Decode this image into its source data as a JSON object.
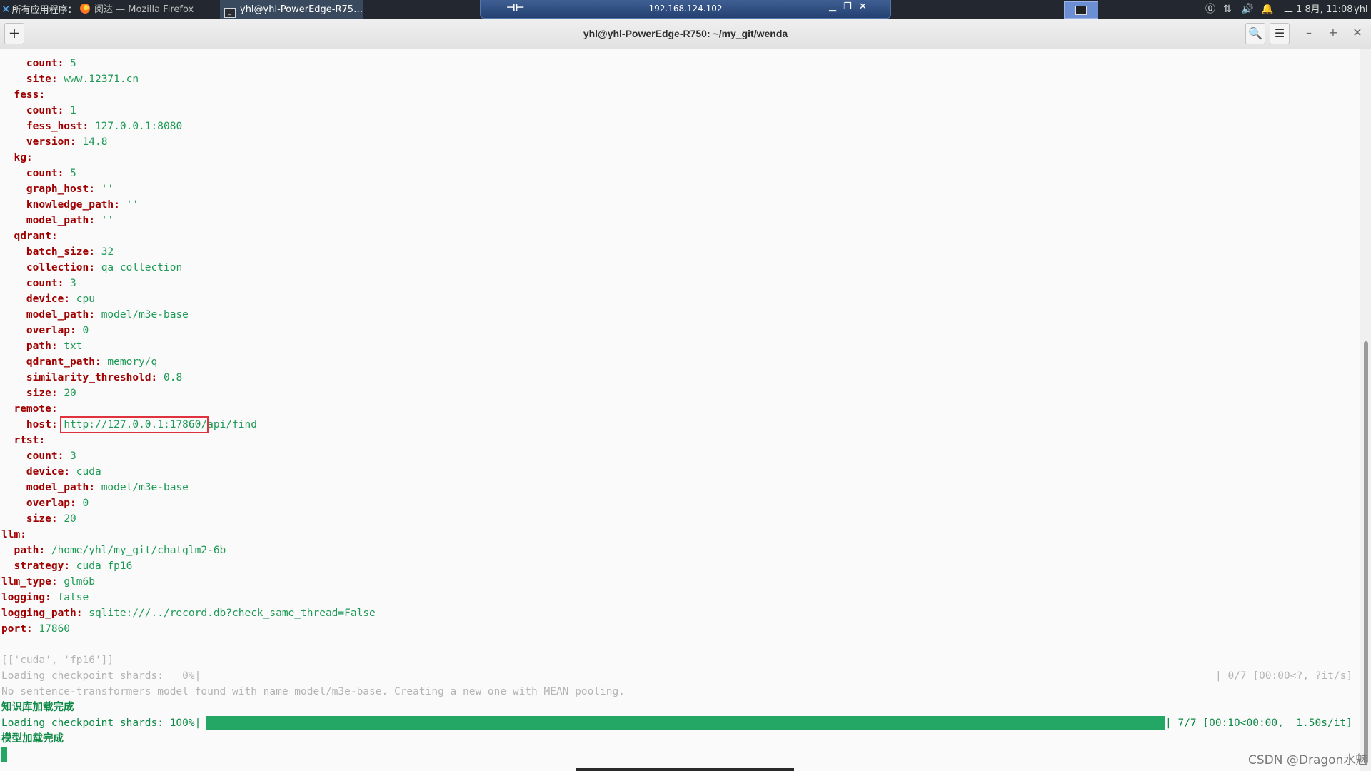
{
  "panel": {
    "apps_label": "所有应用程序：",
    "task1": "阅达 — Mozilla Firefox",
    "task2": "yhl@yhl-PowerEdge-R75…",
    "vnc_ip": "192.168.124.102",
    "clock": "二 1 8月, 11:08",
    "user": "yhl"
  },
  "window": {
    "title": "yhl@yhl-PowerEdge-R750: ~/my_git/wenda",
    "new_tab": "+",
    "minimize": "–",
    "maximize": "+",
    "close": "✕"
  },
  "terminal": {
    "lines": [
      {
        "k": "    count: ",
        "v": "5"
      },
      {
        "k": "    site: ",
        "v": "www.12371.cn"
      },
      {
        "k": "  fess:",
        "v": ""
      },
      {
        "k": "    count: ",
        "v": "1"
      },
      {
        "k": "    fess_host: ",
        "v": "127.0.0.1:8080"
      },
      {
        "k": "    version: ",
        "v": "14.8"
      },
      {
        "k": "  kg:",
        "v": ""
      },
      {
        "k": "    count: ",
        "v": "5"
      },
      {
        "k": "    graph_host: ",
        "v": "''"
      },
      {
        "k": "    knowledge_path: ",
        "v": "''"
      },
      {
        "k": "    model_path: ",
        "v": "''"
      },
      {
        "k": "  qdrant:",
        "v": ""
      },
      {
        "k": "    batch_size: ",
        "v": "32"
      },
      {
        "k": "    collection: ",
        "v": "qa_collection"
      },
      {
        "k": "    count: ",
        "v": "3"
      },
      {
        "k": "    device: ",
        "v": "cpu"
      },
      {
        "k": "    model_path: ",
        "v": "model/m3e-base"
      },
      {
        "k": "    overlap: ",
        "v": "0"
      },
      {
        "k": "    path: ",
        "v": "txt"
      },
      {
        "k": "    qdrant_path: ",
        "v": "memory/q"
      },
      {
        "k": "    similarity_threshold: ",
        "v": "0.8"
      },
      {
        "k": "    size: ",
        "v": "20"
      },
      {
        "k": "  remote:",
        "v": ""
      },
      {
        "k": "    host: ",
        "v": "http://127.0.0.1:17860/api/find"
      },
      {
        "k": "  rtst:",
        "v": ""
      },
      {
        "k": "    count: ",
        "v": "3"
      },
      {
        "k": "    device: ",
        "v": "cuda"
      },
      {
        "k": "    model_path: ",
        "v": "model/m3e-base"
      },
      {
        "k": "    overlap: ",
        "v": "0"
      },
      {
        "k": "    size: ",
        "v": "20"
      },
      {
        "k": "llm:",
        "v": ""
      },
      {
        "k": "  path: ",
        "v": "/home/yhl/my_git/chatglm2-6b"
      },
      {
        "k": "  strategy: ",
        "v": "cuda fp16"
      },
      {
        "k": "llm_type: ",
        "v": "glm6b"
      },
      {
        "k": "logging: ",
        "v": "false"
      },
      {
        "k": "logging_path: ",
        "v": "sqlite:///../record.db?check_same_thread=False"
      },
      {
        "k": "port: ",
        "v": "17860"
      }
    ],
    "list_line": "[['cuda', 'fp16']]",
    "loading0_left": "Loading checkpoint shards:   0%|",
    "loading0_right": "| 0/7 [00:00<?, ?it/s]",
    "warning": "No sentence-transformers model found with name model/m3e-base. Creating a new one with MEAN pooling.",
    "kb_done": "知识库加载完成",
    "loading100_left": "Loading checkpoint shards: 100%|",
    "loading100_right": "| 7/7 [00:10<00:00,  1.50s/it]",
    "loading100_progress": 1.0,
    "model_done": "模型加载完成"
  },
  "watermark": "CSDN @Dragon水魅",
  "colors": {
    "key": "#a10000",
    "value": "#1e9a56",
    "progress": "#24a765",
    "highlight_box": "#e0323c"
  }
}
